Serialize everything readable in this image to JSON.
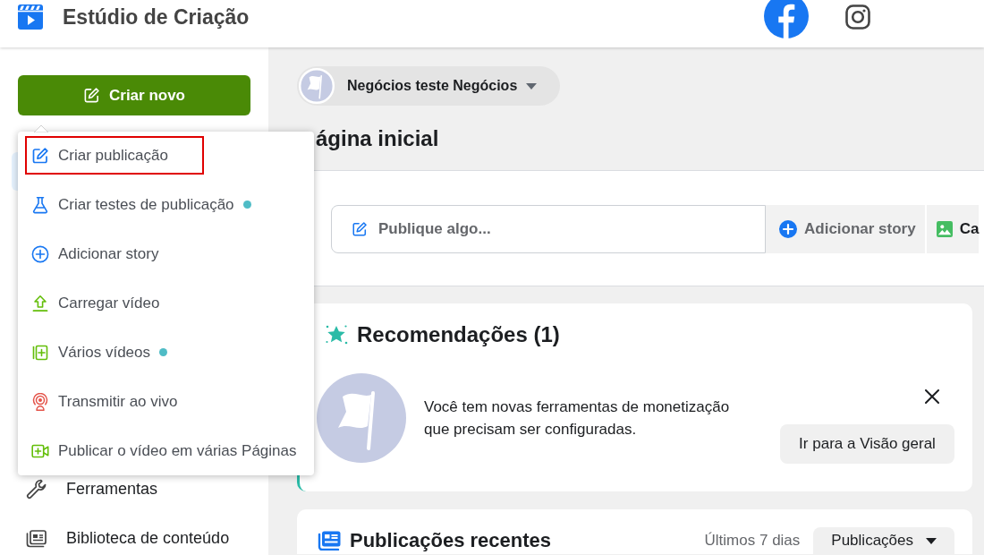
{
  "header": {
    "title": "Estúdio de Criação",
    "platform_tabs": [
      {
        "selected": true
      },
      {
        "selected": false
      }
    ]
  },
  "sidebar": {
    "create_button": "Criar novo",
    "items": [
      {
        "label": "Ferramentas"
      },
      {
        "label": "Biblioteca de conteúdo"
      }
    ]
  },
  "create_menu": {
    "items": [
      {
        "label": "Criar publicação",
        "highlighted": true,
        "new": false
      },
      {
        "label": "Criar testes de publicação",
        "highlighted": false,
        "new": true
      },
      {
        "label": "Adicionar story",
        "highlighted": false,
        "new": false
      },
      {
        "label": "Carregar vídeo",
        "highlighted": false,
        "new": false
      },
      {
        "label": "Vários vídeos",
        "highlighted": false,
        "new": true
      },
      {
        "label": "Transmitir ao vivo",
        "highlighted": false,
        "new": false
      },
      {
        "label": "Publicar o vídeo em várias Páginas",
        "highlighted": false,
        "new": false
      }
    ]
  },
  "page_selector": {
    "name": "Negócios teste Negócios"
  },
  "page_title": "ágina inicial",
  "composer": {
    "placeholder": "Publique algo...",
    "actions": [
      {
        "label": "Adicionar story"
      },
      {
        "label": "Ca"
      }
    ]
  },
  "recommendations": {
    "title": "Recomendações (1)",
    "message": "Você tem novas ferramentas de monetização que precisam ser configuradas.",
    "button": "Ir para a Visão geral"
  },
  "recent_posts": {
    "title": "Publicações recentes",
    "period": "Últimos 7 dias",
    "filter": "Publicações"
  }
}
